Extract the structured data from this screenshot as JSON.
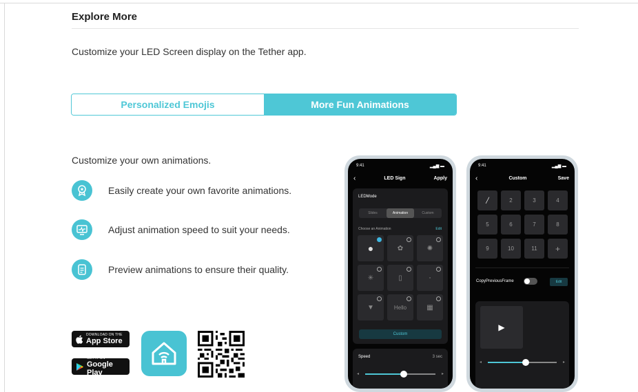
{
  "section": {
    "title": "Explore More",
    "intro": "Customize your LED Screen display on the Tether app."
  },
  "tabs": [
    {
      "label": "Personalized Emojis",
      "active": false
    },
    {
      "label": "More Fun Animations",
      "active": true
    }
  ],
  "content": {
    "subheading": "Customize your own animations.",
    "features": [
      {
        "icon": "badge-icon",
        "text": "Easily create your own favorite animations."
      },
      {
        "icon": "monitor-pulse-icon",
        "text": "Adjust animation speed to suit your needs."
      },
      {
        "icon": "document-icon",
        "text": "Preview animations to ensure their quality."
      }
    ]
  },
  "downloads": {
    "app_store": {
      "small": "DOWNLOAD ON THE",
      "big": "App Store"
    },
    "google_play": {
      "small": "GET IT ON",
      "big": "Google Play"
    }
  },
  "phone1": {
    "time": "9:41",
    "title": "LED Sign",
    "action": "Apply",
    "mode_label": "LEDMode",
    "segments": [
      "Slides",
      "Animation",
      "Custom"
    ],
    "choose_label": "Choose an Animation",
    "edit_label": "Edit",
    "cell_hello": "Hello",
    "custom_button": "Custom",
    "speed_label": "Speed",
    "speed_value": "3 sec",
    "speed_fraction": 0.55
  },
  "phone2": {
    "time": "9:41",
    "title": "Custom",
    "action": "Save",
    "keys": [
      "2",
      "3",
      "4",
      "5",
      "6",
      "7",
      "8",
      "9",
      "10",
      "11",
      "+"
    ],
    "copy_label": "CopyPreviousFrame",
    "edit_label": "Edit",
    "playback_fraction": 0.55
  },
  "colors": {
    "accent": "#4ec7d6",
    "icon_bg": "#49c3d3",
    "phone_bg": "#050505"
  }
}
